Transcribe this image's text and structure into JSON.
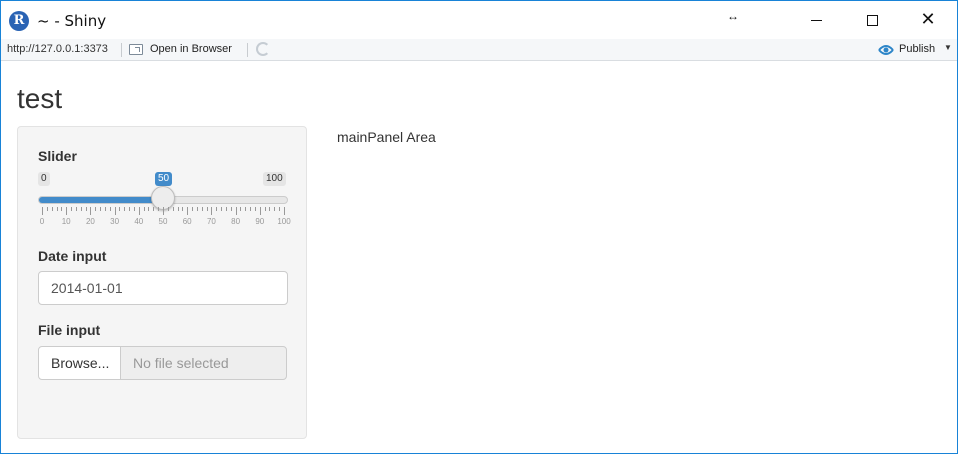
{
  "window": {
    "title": "~ - Shiny",
    "logo_letter": "R",
    "close_glyph": "✕",
    "resize_glyph": "↔"
  },
  "toolbar": {
    "url": "http://127.0.0.1:3373",
    "open_in_browser": "Open in Browser",
    "publish": "Publish",
    "publish_caret": "▼",
    "publish_color": "#2c85c8"
  },
  "page": {
    "title": "test"
  },
  "sidebar": {
    "slider": {
      "label": "Slider",
      "min": "0",
      "max": "100",
      "value": "50",
      "value_fraction": 0.5,
      "tick_labels": [
        "0",
        "10",
        "20",
        "30",
        "40",
        "50",
        "60",
        "70",
        "80",
        "90",
        "100"
      ]
    },
    "date_input": {
      "label": "Date input",
      "value": "2014-01-01"
    },
    "file_input": {
      "label": "File input",
      "button": "Browse...",
      "placeholder": "No file selected"
    }
  },
  "main_panel": {
    "text": "mainPanel Area"
  }
}
